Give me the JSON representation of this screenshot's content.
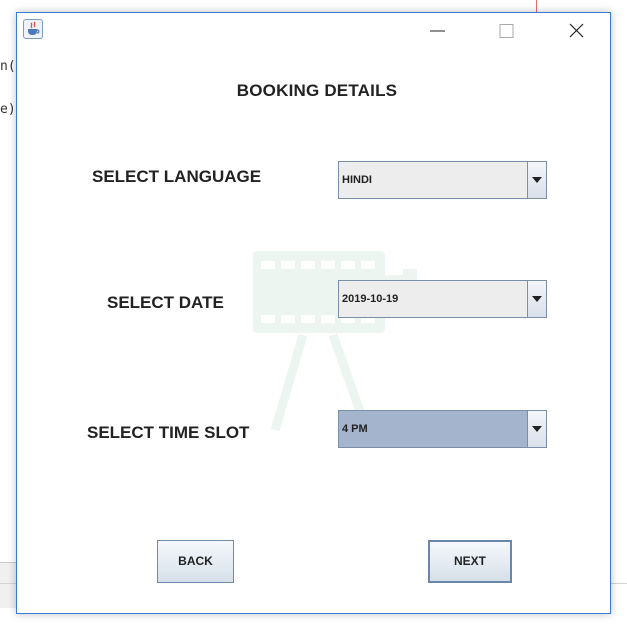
{
  "background": {
    "fragment_1": "n(",
    "fragment_2": "e)"
  },
  "window": {
    "icon": "java-icon",
    "controls": [
      "minimize-icon",
      "maximize-icon",
      "close-icon"
    ]
  },
  "heading": "BOOKING DETAILS",
  "fields": {
    "language": {
      "label": "SELECT LANGUAGE",
      "value": "HINDI"
    },
    "date": {
      "label": "SELECT DATE",
      "value": "2019-10-19"
    },
    "time_slot": {
      "label": "SELECT TIME SLOT",
      "value": "4 PM"
    }
  },
  "buttons": {
    "back": "BACK",
    "next": "NEXT"
  },
  "colors": {
    "window_border": "#3a7bd5",
    "selected_combo": "#a3b4cc",
    "combo_bg": "#ededed"
  }
}
